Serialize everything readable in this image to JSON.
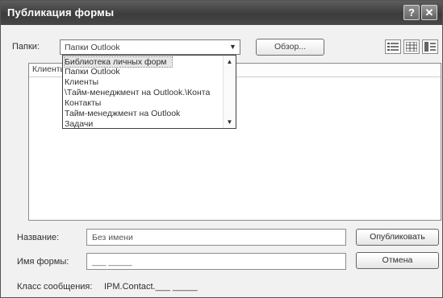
{
  "window": {
    "title": "Публикация формы",
    "help_glyph": "?",
    "close_glyph": "✕"
  },
  "folder": {
    "label": "Папки:",
    "selected": "Папки Outlook",
    "browse_label": "Обзор..."
  },
  "list": {
    "header_visible": "Клиенты"
  },
  "dropdown": {
    "items": [
      "Библиотека личных форм",
      "Папки Outlook",
      "Клиенты",
      "\\Тайм-менеджмент на Outlook.\\Конта",
      "Контакты",
      "Тайм-менеджмент на Outlook",
      "Задачи"
    ],
    "selected_index": 0
  },
  "form": {
    "name_label": "Название:",
    "name_value": "Без имени",
    "form_name_label": "Имя формы:",
    "form_name_value": "___ _____",
    "message_class_label": "Класс сообщения:",
    "message_class_value": "IPM.Contact.___ _____",
    "publish_label": "Опубликовать",
    "cancel_label": "Отмена"
  }
}
